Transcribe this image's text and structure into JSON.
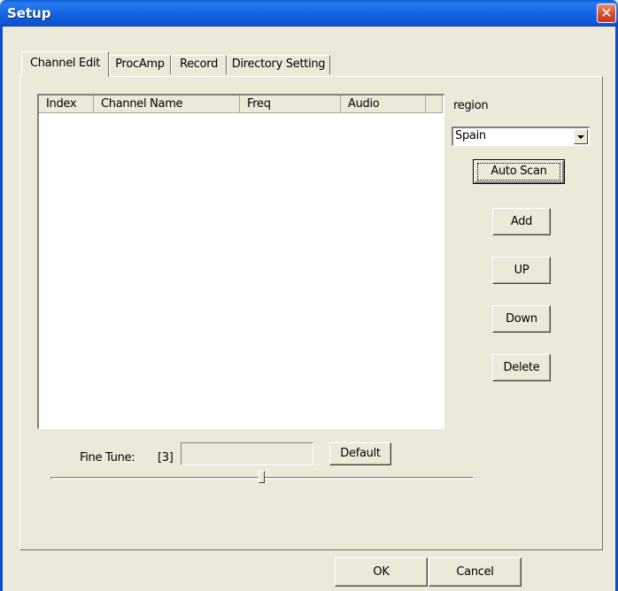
{
  "window": {
    "title": "Setup",
    "close_glyph": "✕"
  },
  "tabs": [
    {
      "label": "Channel Edit",
      "active": true
    },
    {
      "label": "ProcAmp",
      "active": false
    },
    {
      "label": "Record",
      "active": false
    },
    {
      "label": "Directory Setting",
      "active": false
    }
  ],
  "channel_list": {
    "columns": [
      "Index",
      "Channel Name",
      "Freq",
      "Audio",
      ""
    ],
    "rows": []
  },
  "region": {
    "label": "region",
    "selected": "Spain"
  },
  "buttons": {
    "auto_scan": "Auto Scan",
    "add": "Add",
    "up": "UP",
    "down": "Down",
    "delete": "Delete",
    "default": "Default",
    "ok": "OK",
    "cancel": "Cancel"
  },
  "fine_tune": {
    "label": "Fine Tune:",
    "value_display": "[3]",
    "field_value": "",
    "slider_fraction": 0.5
  },
  "colors": {
    "title_bar": "#1565e4",
    "face": "#ece9d8",
    "close_button": "#d5482a"
  },
  "icons": [
    "close-icon",
    "dropdown-arrow-icon"
  ]
}
